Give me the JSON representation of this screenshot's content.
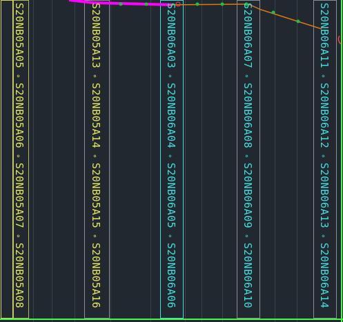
{
  "drawing": {
    "colors": {
      "background": "#212830",
      "yellow_labels": "#e6e65a",
      "cyan_labels": "#40e0e0",
      "magenta_route": "#ff00ff",
      "orange_route": "#e07810",
      "route_nodes": "#20c040",
      "boundary_green": "#40ff40",
      "frame_gray": "#8a8e96"
    },
    "columns": [
      {
        "id": "col-1",
        "color": "yellow",
        "labels": [
          "S20NB05A05",
          "S20NB05A06",
          "S20NB05A07",
          "S20NB05A08"
        ]
      },
      {
        "id": "col-2",
        "color": "yellow",
        "labels": [
          "S20NB05A13",
          "S20NB05A14",
          "S20NB05A15",
          "S20NB05A16"
        ]
      },
      {
        "id": "col-3",
        "color": "cyan",
        "labels": [
          "S20NB06A03",
          "S20NB06A04",
          "S20NB06A05",
          "S20NB06A06"
        ]
      },
      {
        "id": "col-4",
        "color": "cyan",
        "labels": [
          "S20NB06A07",
          "S20NB06A08",
          "S20NB06A09",
          "S20NB06A10"
        ]
      },
      {
        "id": "col-5",
        "color": "cyan",
        "labels": [
          "S20NB06A11",
          "S20NB06A12",
          "S20NB06A13",
          "S20NB06A14"
        ]
      }
    ],
    "separator": "∘"
  }
}
